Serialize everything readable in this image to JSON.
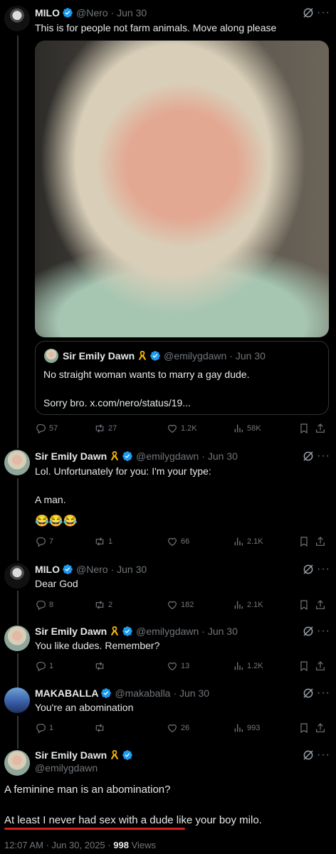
{
  "tweets": [
    {
      "name": "MILO",
      "handle": "@Nero",
      "date": "· Jun 30",
      "text": "This is for people not farm animals. Move along please",
      "quote": {
        "name": "Sir Emily Dawn",
        "handle": "@emilygdawn",
        "date": "· Jun 30",
        "text": "No straight woman wants to marry a gay dude.\n\nSorry bro. x.com/nero/status/19..."
      },
      "stats": {
        "replies": "57",
        "reposts": "27",
        "likes": "1.2K",
        "views": "58K"
      }
    },
    {
      "name": "Sir Emily Dawn",
      "handle": "@emilygdawn",
      "date": "· Jun 30",
      "text": "Lol. Unfortunately for you: I'm your type:\n\nA man.",
      "emoji": "😂😂😂",
      "stats": {
        "replies": "7",
        "reposts": "1",
        "likes": "66",
        "views": "2.1K"
      }
    },
    {
      "name": "MILO",
      "handle": "@Nero",
      "date": "· Jun 30",
      "text": "Dear God",
      "stats": {
        "replies": "8",
        "reposts": "2",
        "likes": "182",
        "views": "2.1K"
      }
    },
    {
      "name": "Sir Emily Dawn",
      "handle": "@emilygdawn",
      "date": "· Jun 30",
      "text": "You like dudes. Remember?",
      "stats": {
        "replies": "1",
        "reposts": "",
        "likes": "13",
        "views": "1.2K"
      }
    },
    {
      "name": "MAKABALLA",
      "handle": "@makaballa",
      "date": "· Jun 30",
      "text": "You're an abomination",
      "stats": {
        "replies": "1",
        "reposts": "",
        "likes": "26",
        "views": "993"
      }
    }
  ],
  "main": {
    "name": "Sir Emily Dawn",
    "handle": "@emilygdawn",
    "line1": "A feminine man is an abomination?",
    "line2": "At least I never had sex with a dude like your boy milo.",
    "timestamp": "12:07 AM · Jun 30, 2025 ·",
    "views_count": "998",
    "views_label": "Views"
  },
  "colors": {
    "accent": "#1d9bf0",
    "muted": "#71767b",
    "underline": "#d61f1f",
    "ribbon": "#f4b400"
  },
  "icons": [
    "verified-icon",
    "gold-ribbon-icon",
    "grok-icon",
    "more-icon",
    "reply-icon",
    "repost-icon",
    "like-icon",
    "views-icon",
    "bookmark-icon",
    "share-icon"
  ]
}
